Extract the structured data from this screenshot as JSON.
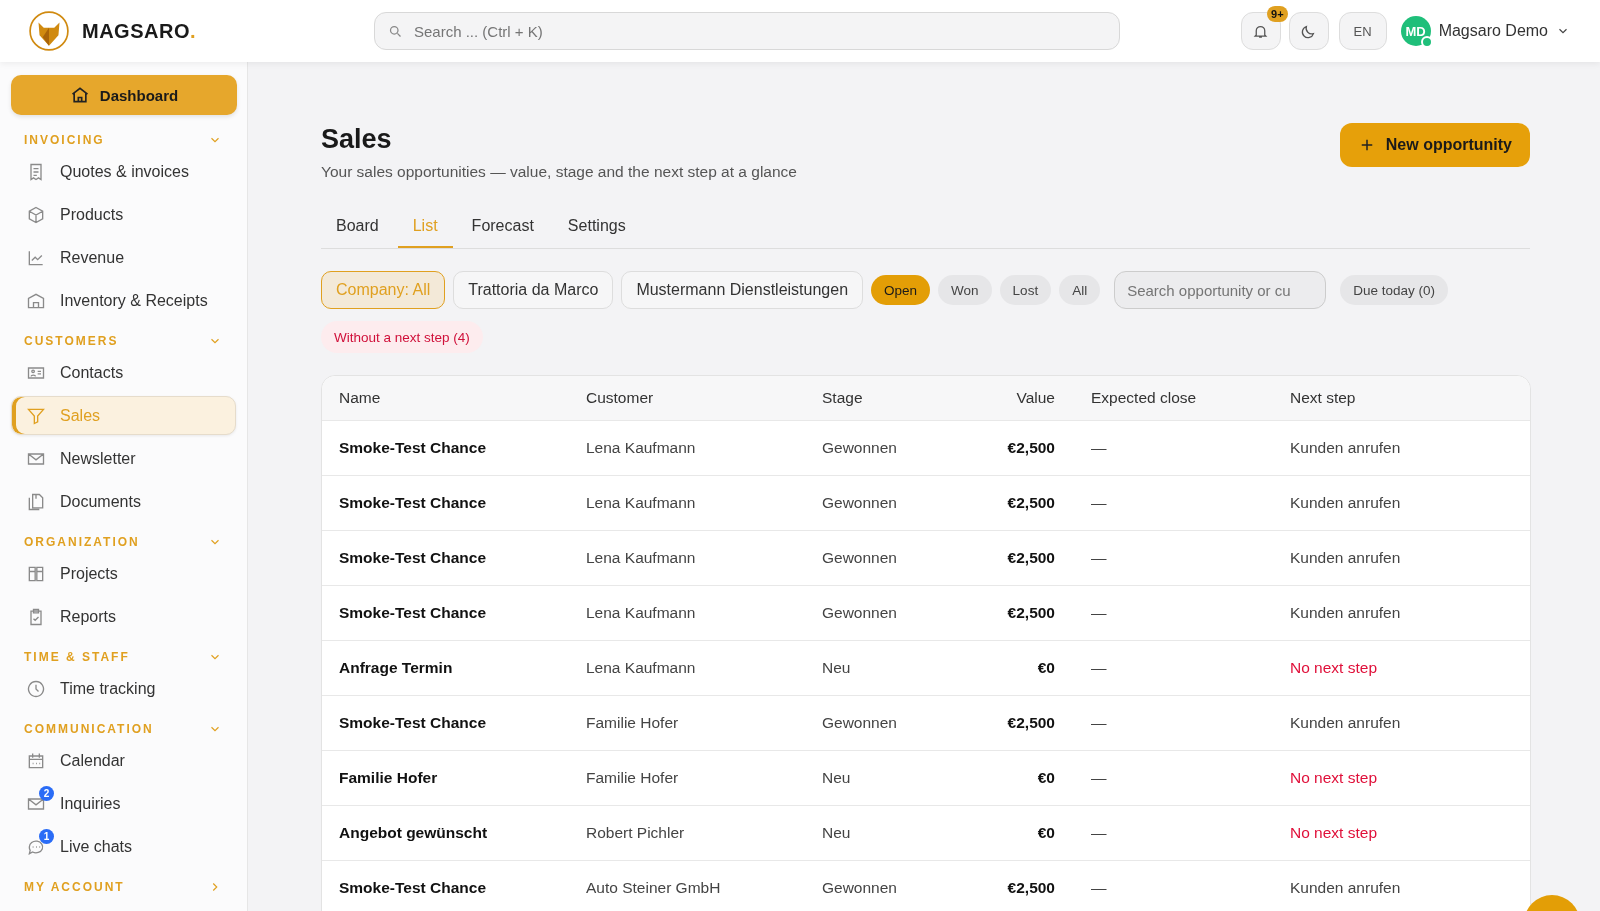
{
  "brand": {
    "name": "MAGSARO",
    "dot": "."
  },
  "search": {
    "placeholder": "Search ... (Ctrl + K)"
  },
  "topbar": {
    "notifications": "9+",
    "language": "EN",
    "user": {
      "initials": "MD",
      "name": "Magsaro Demo",
      "online": true
    }
  },
  "sidebar": {
    "dashboard": "Dashboard",
    "sections": [
      {
        "title": "INVOICING",
        "expanded": true,
        "items": [
          {
            "label": "Quotes & invoices",
            "selected": false
          },
          {
            "label": "Products",
            "selected": false
          },
          {
            "label": "Revenue",
            "selected": false
          },
          {
            "label": "Inventory & Receipts",
            "selected": false
          }
        ]
      },
      {
        "title": "CUSTOMERS",
        "expanded": true,
        "items": [
          {
            "label": "Contacts",
            "selected": false
          },
          {
            "label": "Sales",
            "selected": true
          },
          {
            "label": "Newsletter",
            "selected": false
          },
          {
            "label": "Documents",
            "selected": false
          }
        ]
      },
      {
        "title": "ORGANIZATION",
        "expanded": true,
        "items": [
          {
            "label": "Projects",
            "selected": false
          },
          {
            "label": "Reports",
            "selected": false
          }
        ]
      },
      {
        "title": "TIME & STAFF",
        "expanded": true,
        "items": [
          {
            "label": "Time tracking",
            "selected": false
          }
        ]
      },
      {
        "title": "COMMUNICATION",
        "expanded": true,
        "items": [
          {
            "label": "Calendar",
            "selected": false
          },
          {
            "label": "Inquiries",
            "selected": false,
            "badge": "2"
          },
          {
            "label": "Live chats",
            "selected": false,
            "badge": "1"
          }
        ]
      },
      {
        "title": "MY ACCOUNT",
        "expanded": false
      }
    ]
  },
  "page": {
    "title": "Sales",
    "subtitle": "Your sales opportunities — value, stage and the next step at a glance",
    "new_button": "New opportunity"
  },
  "tabs": [
    {
      "label": "Board",
      "selected": false
    },
    {
      "label": "List",
      "selected": true
    },
    {
      "label": "Forecast",
      "selected": false
    },
    {
      "label": "Settings",
      "selected": false
    }
  ],
  "company_filters": [
    {
      "label": "Company: All",
      "selected": true
    },
    {
      "label": "Trattoria da Marco",
      "selected": false
    },
    {
      "label": "Mustermann Dienstleistungen",
      "selected": false
    }
  ],
  "status_filters": [
    {
      "label": "Open",
      "selected": true
    },
    {
      "label": "Won",
      "selected": false
    },
    {
      "label": "Lost",
      "selected": false
    },
    {
      "label": "All",
      "selected": false
    }
  ],
  "filter_search": {
    "placeholder": "Search opportunity or cu"
  },
  "due_today": "Due today (0)",
  "without_next_step": "Without a next step (4)",
  "table": {
    "columns": [
      "Name",
      "Customer",
      "Stage",
      "Value",
      "Expected close",
      "Next step"
    ],
    "rows": [
      {
        "name": "Smoke-Test Chance",
        "customer": "Lena Kaufmann",
        "stage": "Gewonnen",
        "value": "€2,500",
        "expected_close": "—",
        "next_step": "Kunden anrufen",
        "missing_step": false
      },
      {
        "name": "Smoke-Test Chance",
        "customer": "Lena Kaufmann",
        "stage": "Gewonnen",
        "value": "€2,500",
        "expected_close": "—",
        "next_step": "Kunden anrufen",
        "missing_step": false
      },
      {
        "name": "Smoke-Test Chance",
        "customer": "Lena Kaufmann",
        "stage": "Gewonnen",
        "value": "€2,500",
        "expected_close": "—",
        "next_step": "Kunden anrufen",
        "missing_step": false
      },
      {
        "name": "Smoke-Test Chance",
        "customer": "Lena Kaufmann",
        "stage": "Gewonnen",
        "value": "€2,500",
        "expected_close": "—",
        "next_step": "Kunden anrufen",
        "missing_step": false
      },
      {
        "name": "Anfrage Termin",
        "customer": "Lena Kaufmann",
        "stage": "Neu",
        "value": "€0",
        "expected_close": "—",
        "next_step": "No next step",
        "missing_step": true
      },
      {
        "name": "Smoke-Test Chance",
        "customer": "Familie Hofer",
        "stage": "Gewonnen",
        "value": "€2,500",
        "expected_close": "—",
        "next_step": "Kunden anrufen",
        "missing_step": false
      },
      {
        "name": "Familie Hofer",
        "customer": "Familie Hofer",
        "stage": "Neu",
        "value": "€0",
        "expected_close": "—",
        "next_step": "No next step",
        "missing_step": true
      },
      {
        "name": "Angebot gewünscht",
        "customer": "Robert Pichler",
        "stage": "Neu",
        "value": "€0",
        "expected_close": "—",
        "next_step": "No next step",
        "missing_step": true
      },
      {
        "name": "Smoke-Test Chance",
        "customer": "Auto Steiner GmbH",
        "stage": "Gewonnen",
        "value": "€2,500",
        "expected_close": "—",
        "next_step": "Kunden anrufen",
        "missing_step": false
      }
    ]
  }
}
